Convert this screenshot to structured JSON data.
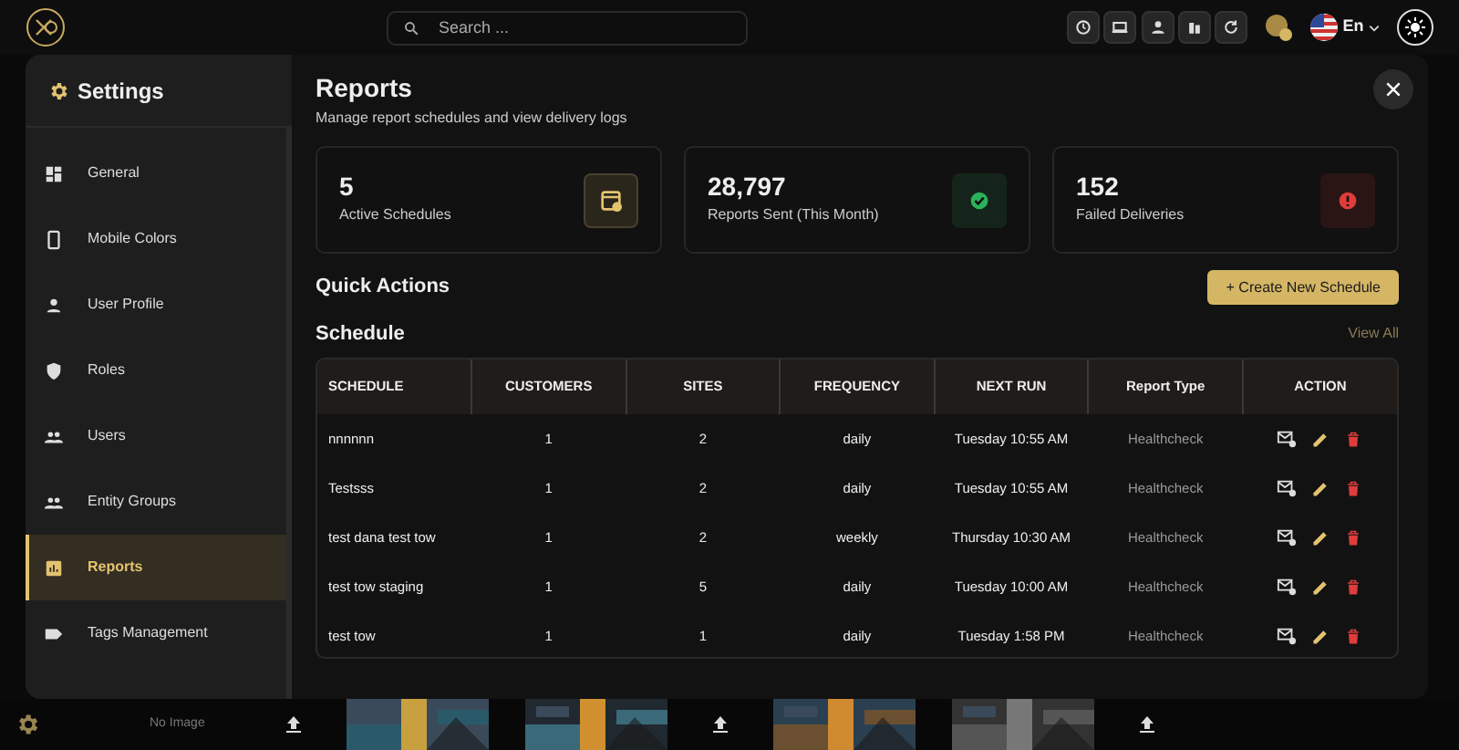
{
  "topbar": {
    "search": {
      "placeholder": "Search ..."
    },
    "language": "En"
  },
  "settings": {
    "title": "Settings",
    "items": [
      {
        "label": "General",
        "selected": false
      },
      {
        "label": "Mobile Colors",
        "selected": false
      },
      {
        "label": "User Profile",
        "selected": false
      },
      {
        "label": "Roles",
        "selected": false
      },
      {
        "label": "Users",
        "selected": false
      },
      {
        "label": "Entity Groups",
        "selected": false
      },
      {
        "label": "Reports",
        "selected": true
      },
      {
        "label": "Tags Management",
        "selected": false
      }
    ]
  },
  "page": {
    "title": "Reports",
    "subtitle": "Manage report schedules and view delivery logs"
  },
  "stats": [
    {
      "value": "5",
      "label": "Active Schedules",
      "kind": "accent"
    },
    {
      "value": "28,797",
      "label": "Reports Sent (This Month)",
      "kind": "success"
    },
    {
      "value": "152",
      "label": "Failed Deliveries",
      "kind": "danger"
    }
  ],
  "quick_actions": {
    "title": "Quick Actions",
    "button": "+ Create New Schedule"
  },
  "schedule": {
    "title": "Schedule",
    "link": "View All",
    "columns": [
      "SCHEDULE",
      "CUSTOMERS",
      "SITES",
      "FREQUENCY",
      "NEXT RUN",
      "Report Type",
      "ACTION"
    ],
    "rows": [
      {
        "schedule": "nnnnnn",
        "customers": "1",
        "sites": "2",
        "frequency": "daily",
        "next_run": "Tuesday 10:55 AM",
        "report_type": "Healthcheck"
      },
      {
        "schedule": "Testsss",
        "customers": "1",
        "sites": "2",
        "frequency": "daily",
        "next_run": "Tuesday 10:55 AM",
        "report_type": "Healthcheck"
      },
      {
        "schedule": "test dana test tow",
        "customers": "1",
        "sites": "2",
        "frequency": "weekly",
        "next_run": "Thursday 10:30 AM",
        "report_type": "Healthcheck"
      },
      {
        "schedule": "test tow staging",
        "customers": "1",
        "sites": "5",
        "frequency": "daily",
        "next_run": "Tuesday 10:00 AM",
        "report_type": "Healthcheck"
      },
      {
        "schedule": "test tow",
        "customers": "1",
        "sites": "1",
        "frequency": "daily",
        "next_run": "Tuesday 1:58 PM",
        "report_type": "Healthcheck"
      }
    ]
  },
  "background_strip": {
    "tiles": [
      {
        "kind": "empty",
        "text": "No Image"
      },
      {
        "kind": "picture"
      },
      {
        "kind": "picture"
      },
      {
        "kind": "picture"
      },
      {
        "kind": "picture"
      }
    ]
  }
}
